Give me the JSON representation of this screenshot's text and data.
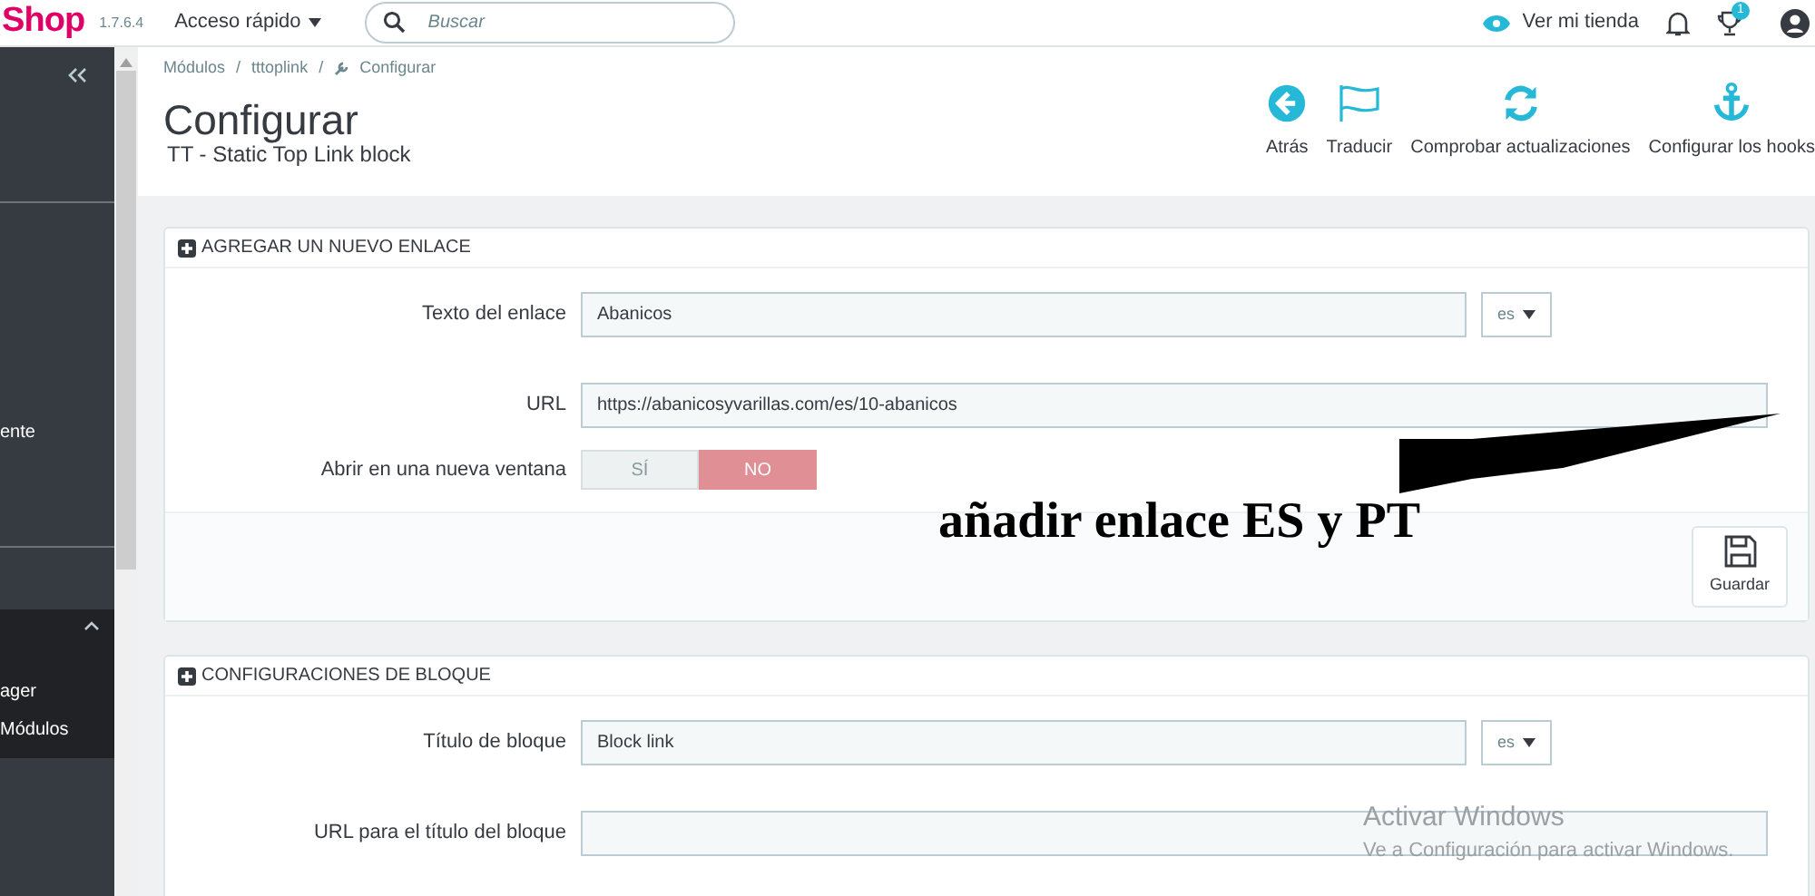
{
  "topbar": {
    "logo": "Shop",
    "version": "1.7.6.4",
    "quick_access": "Acceso rápido",
    "search": {
      "placeholder": "Buscar"
    },
    "view_store": "Ver mi tienda",
    "notification_count": "1"
  },
  "sidebar": {
    "items": [
      {
        "label": "ente"
      }
    ],
    "section": {
      "expanded": true,
      "items": [
        {
          "label": "ager"
        },
        {
          "label": "Módulos"
        }
      ]
    }
  },
  "breadcrumb": {
    "separator": "/",
    "items": [
      "Módulos",
      "tttoplink",
      "Configurar"
    ]
  },
  "page": {
    "title": "Configurar",
    "subtitle": "TT - Static Top Link block"
  },
  "toolbar": [
    {
      "kind": "back",
      "label": "Atrás"
    },
    {
      "kind": "translate",
      "label": "Traducir"
    },
    {
      "kind": "refresh",
      "label": "Comprobar actualizaciones"
    },
    {
      "kind": "hooks",
      "label": "Configurar los hooks"
    }
  ],
  "panels": [
    {
      "title": "AGREGAR UN NUEVO ENLACE",
      "rows": [
        {
          "kind": "text",
          "label": "Texto del enlace",
          "value": "Abanicos",
          "lang": "es"
        },
        {
          "kind": "wide",
          "label": "URL",
          "value": "https://abanicosyvarillas.com/es/10-abanicos"
        },
        {
          "kind": "toggle",
          "label": "Abrir en una nueva ventana",
          "options": [
            {
              "label": "SÍ",
              "selected": false
            },
            {
              "label": "NO",
              "selected": true
            }
          ]
        }
      ],
      "save": "Guardar"
    },
    {
      "title": "CONFIGURACIONES DE BLOQUE",
      "rows": [
        {
          "kind": "text",
          "label": "Título de bloque",
          "value": "Block link",
          "lang": "es"
        },
        {
          "kind": "wide",
          "label": "URL para el título del bloque"
        }
      ]
    }
  ],
  "annotation": "añadir enlace ES y PT",
  "os_notice": {
    "title": "Activar Windows",
    "text": "Ve a Configuración para activar Windows."
  }
}
